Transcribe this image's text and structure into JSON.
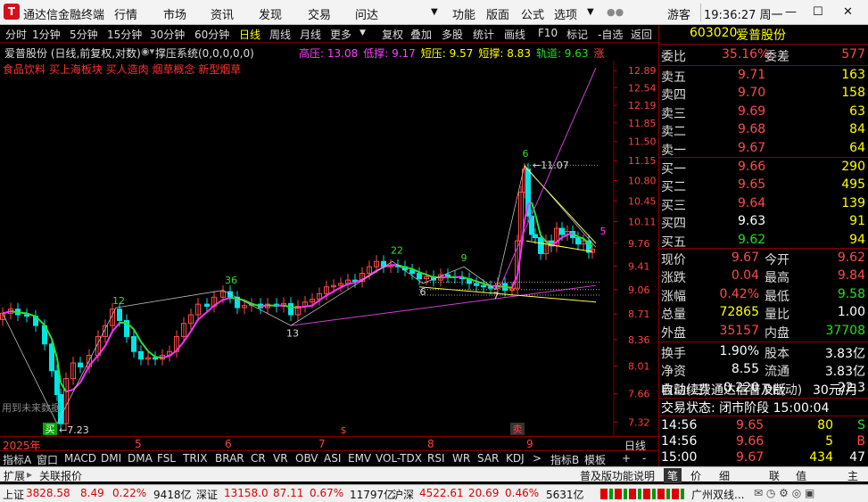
{
  "titlebar": {
    "app_name": "通达信金融终端",
    "menus": [
      "行情",
      "市场",
      "资讯",
      "发现",
      "交易",
      "问达"
    ],
    "right_menus": [
      "功能",
      "版面",
      "公式",
      "选项"
    ],
    "user": "游客",
    "clock": "19:36:27 周一"
  },
  "toolbar": {
    "buttons": [
      "分时",
      "1分钟",
      "5分钟",
      "15分钟",
      "30分钟",
      "60分钟",
      "日线",
      "周线",
      "月线",
      "更多",
      "复权",
      "叠加",
      "多股",
      "统计",
      "画线",
      "F10",
      "标记",
      "-自选",
      "返回"
    ]
  },
  "info": {
    "stock_line": "爱普股份 (日线,前复权,对数)",
    "indicator": "撑压系统(0,0,0,0,0)",
    "values": [
      {
        "label": "高压: 13.08",
        "color": "#ff40ff"
      },
      {
        "label": "低撑: 9.17",
        "color": "#ff40ff"
      },
      {
        "label": "短压: 9.57",
        "color": "#ffff00"
      },
      {
        "label": "短撑: 8.83",
        "color": "#ffff00"
      },
      {
        "label": "轨道: 9.63",
        "color": "#20e020"
      },
      {
        "label": "涨",
        "color": "#ff4040"
      }
    ],
    "concepts": "食品饮料 买上海板块 买人造肉 烟草概念 新型烟草"
  },
  "chart": {
    "y_ticks": [
      "12.89",
      "12.54",
      "12.19",
      "11.85",
      "11.50",
      "11.15",
      "10.80",
      "10.45",
      "10.11",
      "9.76",
      "9.41",
      "9.06",
      "8.71",
      "8.36",
      "8.01",
      "7.66",
      "7.32"
    ],
    "annotations": {
      "low": "7.23",
      "high": "11.07",
      "counts": [
        "12",
        "36",
        "13",
        "22",
        "6",
        "9",
        "7",
        "6",
        "5"
      ],
      "future": "用到未来数据",
      "mark_buy": "买",
      "mark_sell": "卖",
      "mark_s": "$"
    },
    "x_labels": {
      "year": "2025年",
      "m5": "5",
      "m6": "6",
      "m7": "7",
      "m8": "8",
      "m9": "9"
    },
    "period": "日线"
  },
  "chart_data": {
    "type": "candlestick",
    "ylim": [
      7.25,
      12.95
    ],
    "y_scale": "log",
    "high": 11.07,
    "low": 7.23,
    "last": 9.67
  },
  "indicator_tabs": [
    "指标A",
    "窗口",
    "MACD",
    "DMI",
    "DMA",
    "FSL",
    "TRIX",
    "BRAR",
    "CR",
    "VR",
    "OBV",
    "ASI",
    "EMV",
    "VOL-TDX",
    "RSI",
    "WR",
    "SAR",
    "KDJ",
    "指标B",
    "模板"
  ],
  "bottom": {
    "expand": "扩展",
    "related": "关联报价",
    "version": "普及版功能说明",
    "tabs": [
      "笔",
      "价",
      "细",
      "联",
      "值",
      "主"
    ]
  },
  "quote": {
    "code": "603020",
    "name": "爱普股份",
    "wb": {
      "label": "委比",
      "value": "35.16%",
      "diff_label": "委差",
      "diff": "577"
    },
    "asks": [
      {
        "label": "卖五",
        "price": "9.71",
        "vol": "163"
      },
      {
        "label": "卖四",
        "price": "9.70",
        "vol": "158"
      },
      {
        "label": "卖三",
        "price": "9.69",
        "vol": "63"
      },
      {
        "label": "卖二",
        "price": "9.68",
        "vol": "84"
      },
      {
        "label": "卖一",
        "price": "9.67",
        "vol": "64"
      }
    ],
    "bids": [
      {
        "label": "买一",
        "price": "9.66",
        "vol": "290"
      },
      {
        "label": "买二",
        "price": "9.65",
        "vol": "495"
      },
      {
        "label": "买三",
        "price": "9.64",
        "vol": "139"
      },
      {
        "label": "买四",
        "price": "9.63",
        "vol": "91"
      },
      {
        "label": "买五",
        "price": "9.62",
        "vol": "94"
      }
    ],
    "stats": [
      {
        "l1": "现价",
        "v1": "9.67",
        "l2": "今开",
        "v2": "9.62",
        "c1": "red",
        "c2": "red"
      },
      {
        "l1": "涨跌",
        "v1": "0.04",
        "l2": "最高",
        "v2": "9.84",
        "c1": "red",
        "c2": "red"
      },
      {
        "l1": "涨幅",
        "v1": "0.42%",
        "l2": "最低",
        "v2": "9.58",
        "c1": "red",
        "c2": "grn"
      },
      {
        "l1": "总量",
        "v1": "72865",
        "l2": "量比",
        "v2": "1.00",
        "c1": "yel",
        "c2": "wht"
      },
      {
        "l1": "外盘",
        "v1": "35157",
        "l2": "内盘",
        "v2": "37708",
        "c1": "red",
        "c2": "grn"
      }
    ],
    "stats2": [
      {
        "l1": "换手",
        "v1": "1.90%",
        "l2": "股本",
        "v2": "3.83亿"
      },
      {
        "l1": "净资",
        "v1": "8.55",
        "l2": "流通",
        "v2": "3.83亿"
      },
      {
        "l1": "收益(三)",
        "v1": "0.220",
        "l2": "PE(动)",
        "v2": "22.3"
      }
    ],
    "promo": "自动续费通达信普及版",
    "promo_price": "30元/月",
    "trade_state": "交易状态: 闭市阶段 15:00:04",
    "ticks": [
      {
        "time": "14:56",
        "price": "9.65",
        "vol": "80",
        "side": "S"
      },
      {
        "time": "14:56",
        "price": "9.66",
        "vol": "5",
        "side": "B"
      },
      {
        "time": "15:00",
        "price": "9.67",
        "vol": "434",
        "side": "47"
      }
    ]
  },
  "status": {
    "sh_label": "上证",
    "sh_val": "3828.58",
    "sh_chg": "8.49",
    "sh_pct": "0.22%",
    "sh_amt": "9418亿",
    "sz_label": "深证",
    "sz_val": "13158.0",
    "sz_chg": "87.11",
    "sz_pct": "0.67%",
    "sz_amt": "11797亿",
    "hs_label": "沪深",
    "hs_val": "4522.61",
    "hs_chg": "20.69",
    "hs_pct": "0.46%",
    "hs_amt": "5631亿",
    "server": "广州双线..."
  },
  "colors": {
    "up": "#ff4a4a",
    "down": "#20e020",
    "bg": "#000000",
    "grid": "#800000"
  }
}
